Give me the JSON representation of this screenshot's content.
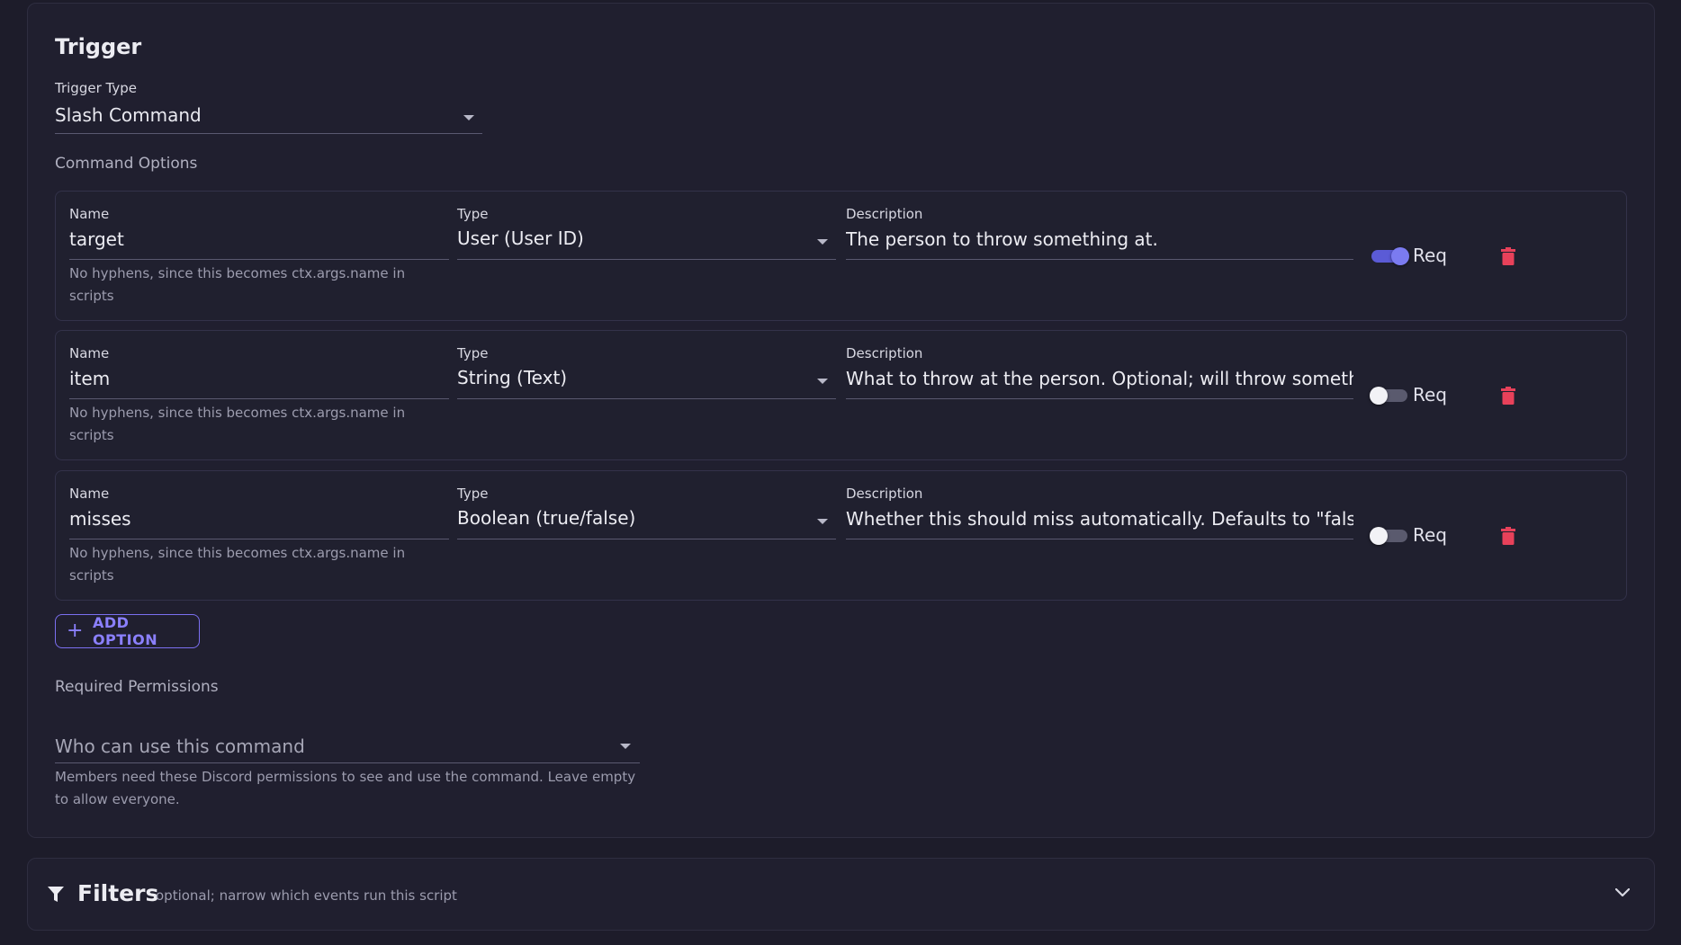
{
  "trigger": {
    "title": "Trigger",
    "type_label": "Trigger Type",
    "type_value": "Slash Command"
  },
  "command_options": {
    "section_label": "Command Options",
    "name_label": "Name",
    "type_label": "Type",
    "description_label": "Description",
    "name_helper": "No hyphens, since this becomes ctx.args.name in scripts",
    "req_label": "Req",
    "options": [
      {
        "name": "target",
        "type": "User (User ID)",
        "description": "The person to throw something at.",
        "required": true
      },
      {
        "name": "item",
        "type": "String (Text)",
        "description": "What to throw at the person. Optional; will throw something",
        "required": false
      },
      {
        "name": "misses",
        "type": "Boolean (true/false)",
        "description": "Whether this should miss automatically. Defaults to \"false\".",
        "required": false
      }
    ],
    "add_button": "ADD OPTION"
  },
  "permissions": {
    "section_label": "Required Permissions",
    "placeholder": "Who can use this command",
    "helper": "Members need these Discord permissions to see and use the command. Leave empty to allow everyone."
  },
  "filters": {
    "title": "Filters",
    "subtitle": "optional; narrow which events run this script"
  },
  "colors": {
    "background": "#1d1c2a",
    "panel": "#201f2f",
    "accent": "#7b6ff0",
    "toggle_on": "#5b5bd6",
    "danger": "#e8415a"
  },
  "icons": {
    "dropdown": "caret-down-icon",
    "delete": "trash-icon",
    "add": "plus-icon",
    "filter": "filter-icon",
    "expand": "chevron-down-icon"
  }
}
